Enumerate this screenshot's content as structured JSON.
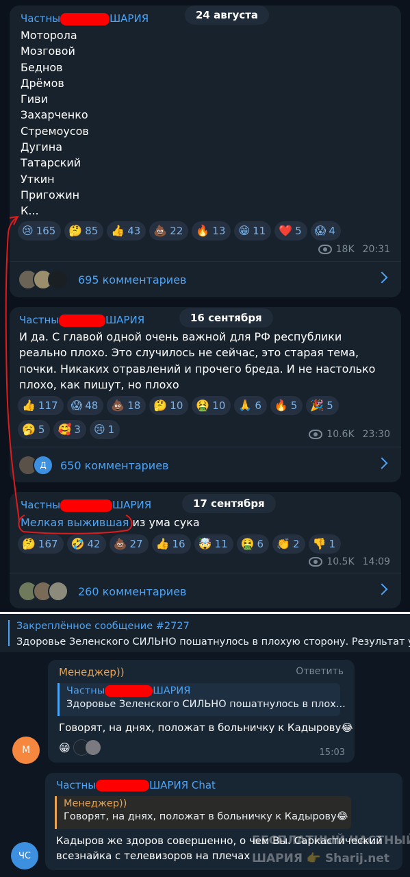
{
  "posts": [
    {
      "author_prefix": "Частны",
      "author_suffix": "ШАРИЯ",
      "date": "24 августа",
      "lines": [
        "Моторола",
        "Мозговой",
        "Беднов",
        "Дрёмов",
        "Гиви",
        "Захарченко",
        "Стремоусов",
        "Дугина",
        "Татарский",
        "Уткин",
        "Пригожин",
        "К..."
      ],
      "reactions": [
        {
          "emoji": "😢",
          "count": "165"
        },
        {
          "emoji": "🤔",
          "count": "85"
        },
        {
          "emoji": "👍",
          "count": "43"
        },
        {
          "emoji": "💩",
          "count": "22"
        },
        {
          "emoji": "🔥",
          "count": "13"
        },
        {
          "emoji": "😁",
          "count": "11"
        },
        {
          "emoji": "❤️",
          "count": "5"
        },
        {
          "emoji": "😱",
          "count": "4"
        }
      ],
      "views": "18K",
      "time": "20:31",
      "comments": "695 комментариев"
    },
    {
      "author_prefix": "Частны",
      "author_suffix": "ШАРИЯ",
      "date": "16 сентября",
      "text": "И да. С главой одной очень важной для РФ республики реально плохо. Это случилось не сейчас, это старая тема, почки. Никаких отравлений и прочего бреда. И не настолько плохо, как пишут, но плохо",
      "reactions_row1": [
        {
          "emoji": "👍",
          "count": "117"
        },
        {
          "emoji": "😱",
          "count": "48"
        },
        {
          "emoji": "💩",
          "count": "18"
        },
        {
          "emoji": "🤔",
          "count": "10"
        },
        {
          "emoji": "🤮",
          "count": "10"
        },
        {
          "emoji": "🙏",
          "count": "6"
        },
        {
          "emoji": "🔥",
          "count": "5"
        },
        {
          "emoji": "🎉",
          "count": "5"
        }
      ],
      "reactions_row2": [
        {
          "emoji": "🥱",
          "count": "5"
        },
        {
          "emoji": "🥰",
          "count": "3"
        },
        {
          "emoji": "😢",
          "count": "1"
        }
      ],
      "views": "10.6K",
      "time": "23:30",
      "comments": "650 комментариев",
      "avatar_letter": "Д"
    },
    {
      "author_prefix": "Частны",
      "author_suffix": "ШАРИЯ",
      "date": "17 сентября",
      "link_text": "Мелкая выжившая",
      "text_rest": "из ума сука",
      "reactions": [
        {
          "emoji": "🤔",
          "count": "167"
        },
        {
          "emoji": "🤣",
          "count": "42"
        },
        {
          "emoji": "💩",
          "count": "27"
        },
        {
          "emoji": "👍",
          "count": "16"
        },
        {
          "emoji": "🤯",
          "count": "11"
        },
        {
          "emoji": "🤮",
          "count": "6"
        },
        {
          "emoji": "👏",
          "count": "2"
        },
        {
          "emoji": "👎",
          "count": "1"
        }
      ],
      "views": "10.5K",
      "time": "14:09",
      "comments": "260 комментариев"
    }
  ],
  "pinned": {
    "title": "Закреплённое сообщение #2727",
    "text": "Здоровье Зеленского СИЛЬНО пошатнулось в плохую сторону. Результат у"
  },
  "chat": [
    {
      "name": "Менеджер))",
      "name_color": "#e8a453",
      "reply_label": "Ответить",
      "quote_prefix": "Частны",
      "quote_suffix": "ШАРИЯ",
      "quote_text": "Здоровье Зеленского СИЛЬНО пошатнулось в плох...",
      "text": "Говорят, на днях, положат в больничку к Кадырову😂",
      "reaction_emoji": "😁",
      "time": "15:03",
      "avatar_letter": "М",
      "avatar_color": "#f5883e"
    },
    {
      "name_prefix": "Частны",
      "name_suffix": "ШАРИЯ Chat",
      "quote_name": "Менеджер))",
      "quote_text": "Говорят, на днях, положат в больничку к Кадырову😂",
      "text_line1": "Кадыров же здоров совершенно, о чем Вы. Саркастический",
      "text_line2": "всезнайка с телевизоров на плечах",
      "avatar_letter": "ЧС",
      "avatar_color": "#3d8fe0"
    }
  ],
  "watermark": {
    "line1": "БЕСПЛАТНЫЙ ЧАСТНЫЙ",
    "line2": "ШАРИЯ 👉 Sharij.net"
  }
}
